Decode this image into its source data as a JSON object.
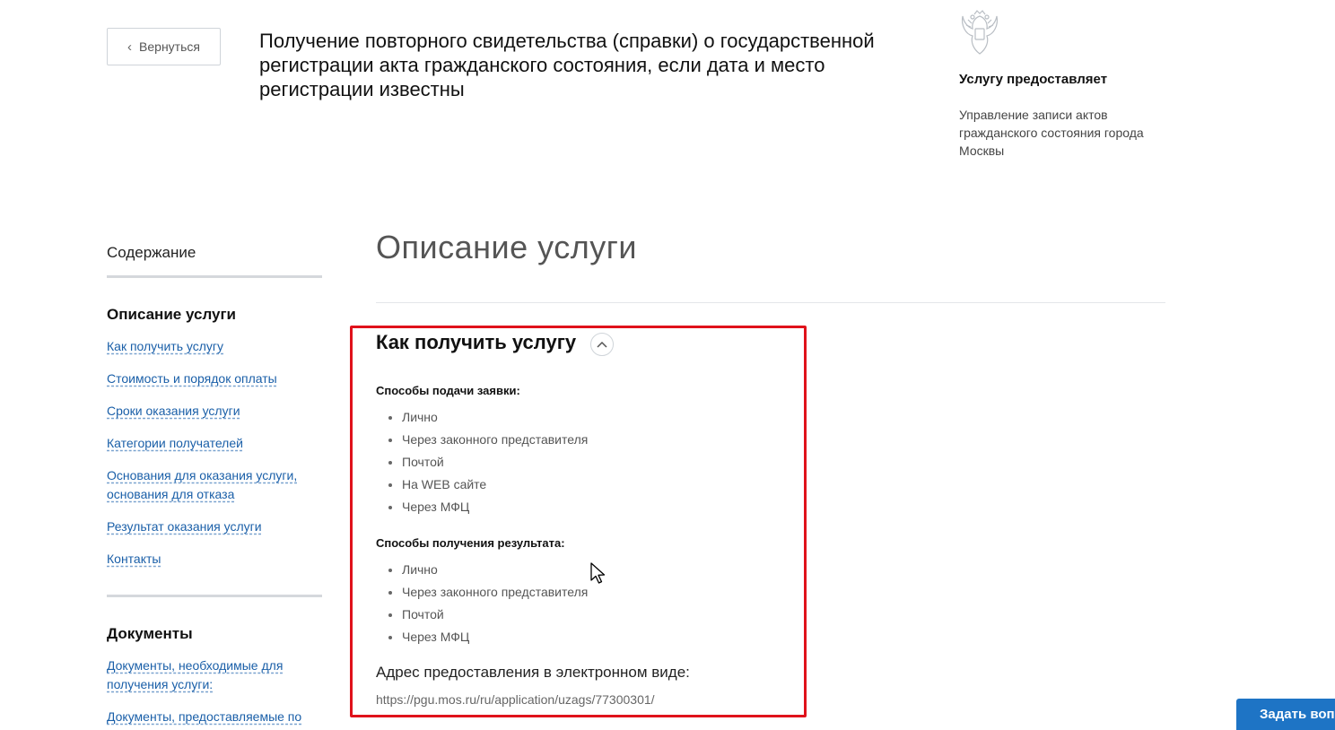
{
  "header": {
    "back_label": "Вернуться",
    "title": "Получение повторного свидетельства (справки) о государственной регистрации акта гражданского состояния, если дата и место регистрации известны"
  },
  "provider": {
    "label": "Услугу предоставляет",
    "name": "Управление записи актов гражданского состояния города Москвы",
    "emblem_icon": "russian-coat-of-arms-icon"
  },
  "sidebar": {
    "title": "Содержание",
    "section1": {
      "title": "Описание услуги",
      "links": [
        "Как получить услугу",
        "Стоимость и порядок оплаты",
        "Сроки оказания услуги",
        "Категории получателей",
        "Основания для оказания услуги, основания для отказа",
        "Результат оказания услуги",
        "Контакты"
      ]
    },
    "section2": {
      "title": "Документы",
      "links": [
        "Документы, необходимые для получения услуги:",
        "Документы, предоставляемые по"
      ]
    }
  },
  "main": {
    "heading": "Описание услуги",
    "subheading": "Как получить услугу",
    "toggle_icon": "chevron-up-icon",
    "submission": {
      "label": "Способы подачи заявки:",
      "items": [
        "Лично",
        "Через законного представителя",
        "Почтой",
        "На WEB сайте",
        "Через МФЦ"
      ]
    },
    "result": {
      "label": "Способы получения результата:",
      "items": [
        "Лично",
        "Через законного представителя",
        "Почтой",
        "Через МФЦ"
      ]
    },
    "address": {
      "label": "Адрес предоставления в электронном виде:",
      "url": "https://pgu.mos.ru/ru/application/uzags/77300301/"
    }
  },
  "chat": {
    "label": "Задать вопрос",
    "icon": "support-agent-icon"
  },
  "colors": {
    "link": "#1a5fa8",
    "highlight": "#e0121b",
    "chat_bg": "#1e74c5"
  }
}
